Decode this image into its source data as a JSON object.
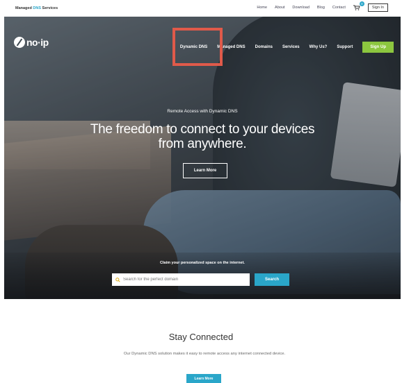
{
  "topbar": {
    "brand_prefix": "Managed ",
    "brand_accent": "DNS",
    "brand_suffix": " Services",
    "links": [
      "Home",
      "About",
      "Download",
      "Blog",
      "Contact"
    ],
    "cart_count": "0",
    "signin_label": "Sign In"
  },
  "header": {
    "logo_text": "no·ip",
    "nav": [
      "Dynamic DNS",
      "Managed DNS",
      "Domains",
      "Services",
      "Why Us?",
      "Support"
    ],
    "signup_label": "Sign Up"
  },
  "hero": {
    "subtitle": "Remote Access with Dynamic DNS",
    "title_line1": "The freedom to connect to your devices",
    "title_line2": "from anywhere.",
    "learn_more_label": "Learn More",
    "claim_text": "Claim your personalized space on the internet.",
    "search_placeholder": "Search for the perfect domain",
    "search_button_label": "Search"
  },
  "stay": {
    "title": "Stay Connected",
    "description": "Our Dynamic DNS solution makes it easy to remote access any internet connected device.",
    "button_label": "Learn More"
  },
  "colors": {
    "accent": "#2aa6c9",
    "signup": "#8cc63f",
    "highlight": "#e05a4a"
  }
}
